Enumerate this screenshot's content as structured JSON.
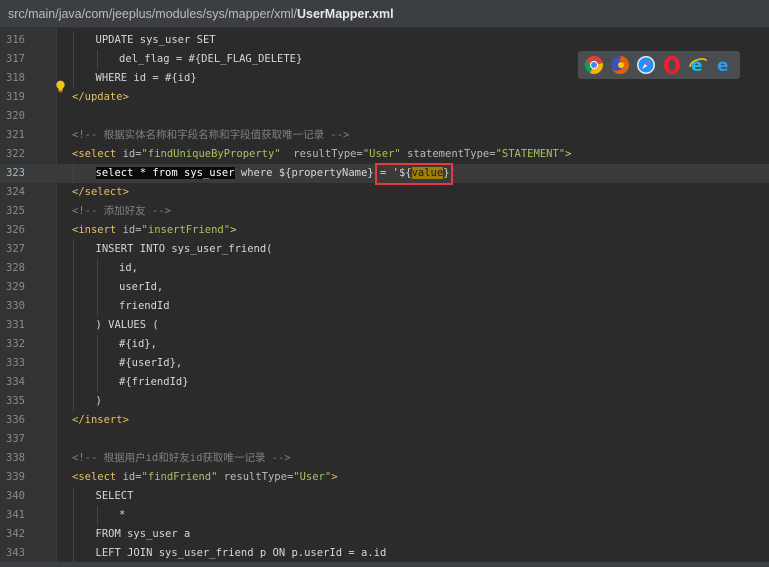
{
  "title": {
    "path": "src/main/java/com/jeeplus/modules/sys/mapper/xml/",
    "file": "UserMapper.xml"
  },
  "lines": [
    {
      "n": "316",
      "indent": 1,
      "segs": [
        {
          "c": "kw",
          "t": "UPDATE sys_user SET"
        }
      ]
    },
    {
      "n": "317",
      "indent": 2,
      "segs": [
        {
          "c": "kw",
          "t": "del_flag = #{DEL_FLAG_DELETE}"
        }
      ]
    },
    {
      "n": "318",
      "indent": 1,
      "segs": [
        {
          "c": "kw",
          "t": "WHERE id = #{id}"
        }
      ]
    },
    {
      "n": "319",
      "indent": 0,
      "segs": [
        {
          "c": "tag",
          "t": "</update>"
        }
      ]
    },
    {
      "n": "320",
      "indent": 0,
      "segs": []
    },
    {
      "n": "321",
      "indent": 0,
      "segs": [
        {
          "c": "cmt",
          "t": "<!-- 根据实体名称和字段名称和字段值获取唯一记录 -->"
        }
      ]
    },
    {
      "n": "322",
      "indent": 0,
      "segs": [
        {
          "c": "tag",
          "t": "<select "
        },
        {
          "c": "attr",
          "t": "id="
        },
        {
          "c": "str",
          "t": "\"findUniqueByProperty\""
        },
        {
          "c": "attr",
          "t": "  resultType="
        },
        {
          "c": "str",
          "t": "\"User\""
        },
        {
          "c": "attr",
          "t": " statementType="
        },
        {
          "c": "str",
          "t": "\"STATEMENT\""
        },
        {
          "c": "tag",
          "t": ">"
        }
      ]
    },
    {
      "n": "323",
      "indent": 1,
      "caret": true,
      "segs": [
        {
          "c": "sel",
          "t": "select * from sys_user"
        },
        {
          "c": "kw",
          "t": " where ${propertyName} = '${"
        },
        {
          "c": "hl",
          "t": "value"
        },
        {
          "c": "kw",
          "t": "}'"
        }
      ]
    },
    {
      "n": "324",
      "indent": 0,
      "segs": [
        {
          "c": "tag",
          "t": "</select>"
        }
      ]
    },
    {
      "n": "325",
      "indent": 0,
      "segs": [
        {
          "c": "cmt",
          "t": "<!-- 添加好友 -->"
        }
      ]
    },
    {
      "n": "326",
      "indent": 0,
      "segs": [
        {
          "c": "tag",
          "t": "<insert "
        },
        {
          "c": "attr",
          "t": "id="
        },
        {
          "c": "str",
          "t": "\"insertFriend\""
        },
        {
          "c": "tag",
          "t": ">"
        }
      ]
    },
    {
      "n": "327",
      "indent": 1,
      "segs": [
        {
          "c": "kw",
          "t": "INSERT INTO sys_user_friend("
        }
      ]
    },
    {
      "n": "328",
      "indent": 2,
      "segs": [
        {
          "c": "kw",
          "t": "id,"
        }
      ]
    },
    {
      "n": "329",
      "indent": 2,
      "segs": [
        {
          "c": "kw",
          "t": "userId,"
        }
      ]
    },
    {
      "n": "330",
      "indent": 2,
      "segs": [
        {
          "c": "kw",
          "t": "friendId"
        }
      ]
    },
    {
      "n": "331",
      "indent": 1,
      "segs": [
        {
          "c": "kw",
          "t": ") VALUES ("
        }
      ]
    },
    {
      "n": "332",
      "indent": 2,
      "segs": [
        {
          "c": "kw",
          "t": "#{id},"
        }
      ]
    },
    {
      "n": "333",
      "indent": 2,
      "segs": [
        {
          "c": "kw",
          "t": "#{userId},"
        }
      ]
    },
    {
      "n": "334",
      "indent": 2,
      "segs": [
        {
          "c": "kw",
          "t": "#{friendId}"
        }
      ]
    },
    {
      "n": "335",
      "indent": 1,
      "segs": [
        {
          "c": "kw",
          "t": ")"
        }
      ]
    },
    {
      "n": "336",
      "indent": 0,
      "segs": [
        {
          "c": "tag",
          "t": "</insert>"
        }
      ]
    },
    {
      "n": "337",
      "indent": 0,
      "segs": []
    },
    {
      "n": "338",
      "indent": 0,
      "segs": [
        {
          "c": "cmt",
          "t": "<!-- 根据用户id和好友id获取唯一记录 -->"
        }
      ]
    },
    {
      "n": "339",
      "indent": 0,
      "segs": [
        {
          "c": "tag",
          "t": "<select "
        },
        {
          "c": "attr",
          "t": "id="
        },
        {
          "c": "str",
          "t": "\"findFriend\""
        },
        {
          "c": "attr",
          "t": " resultType="
        },
        {
          "c": "str",
          "t": "\"User\""
        },
        {
          "c": "tag",
          "t": ">"
        }
      ]
    },
    {
      "n": "340",
      "indent": 1,
      "segs": [
        {
          "c": "kw",
          "t": "SELECT"
        }
      ]
    },
    {
      "n": "341",
      "indent": 2,
      "segs": [
        {
          "c": "kw",
          "t": "*"
        }
      ]
    },
    {
      "n": "342",
      "indent": 1,
      "segs": [
        {
          "c": "kw",
          "t": "FROM sys_user a"
        }
      ]
    },
    {
      "n": "343",
      "indent": 1,
      "segs": [
        {
          "c": "kw",
          "t": "LEFT JOIN sys_user_friend p ON p.userId = a.id"
        }
      ]
    }
  ],
  "browser_icons": [
    {
      "name": "chrome-icon",
      "color": "#4285f4"
    },
    {
      "name": "firefox-icon",
      "color": "#e66000"
    },
    {
      "name": "safari-icon",
      "color": "#1e90ff"
    },
    {
      "name": "opera-icon",
      "color": "#ff1b2d"
    },
    {
      "name": "ie-icon",
      "color": "#1ebbee"
    },
    {
      "name": "edge-icon",
      "color": "#0078d7"
    }
  ],
  "colors": {
    "background": "#2b2b2b",
    "tag": "#e8bf6a",
    "string": "#a5c261",
    "comment": "#808080",
    "highlight": "#a07e00",
    "red_box": "#e03e3e"
  }
}
